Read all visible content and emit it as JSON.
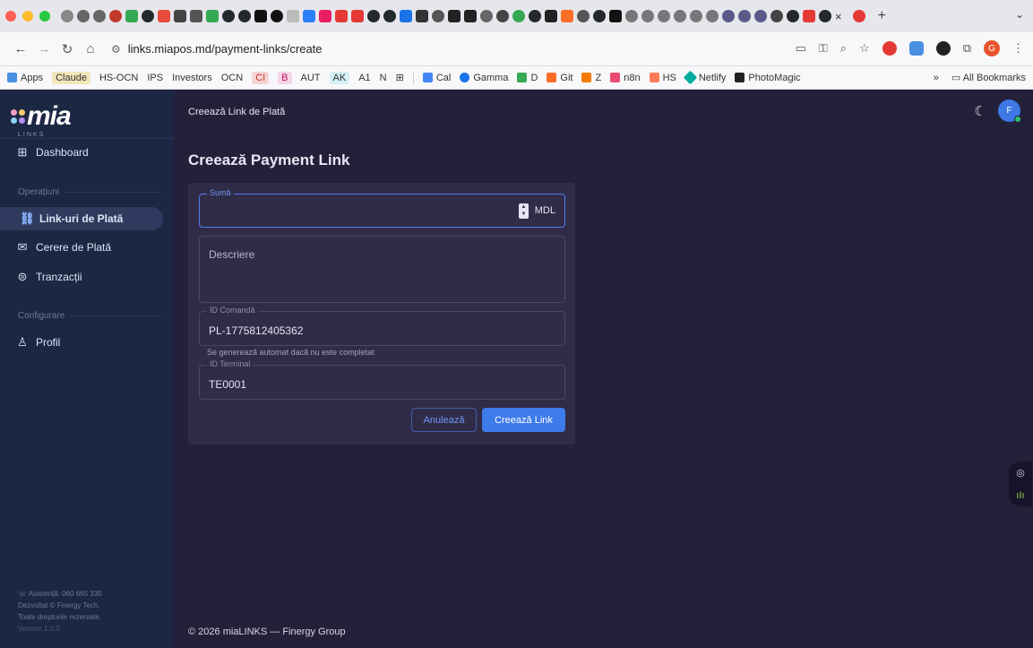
{
  "browser": {
    "url": "links.miapos.md/payment-links/create",
    "bookmarks": [
      "Apps",
      "Claude",
      "HS-OCN",
      "IPS",
      "Investors",
      "OCN",
      "CI",
      "B",
      "AUT",
      "AK",
      "A1",
      "N",
      "Cal",
      "Gamma",
      "D",
      "Git",
      "Z",
      "n8n",
      "HS",
      "Netlify",
      "PhotoMagic"
    ],
    "more_bookmarks": "»",
    "all_bookmarks": "All Bookmarks",
    "tab_close": "×",
    "new_tab": "+",
    "profile_initial": "G"
  },
  "sidebar": {
    "logo_word": "mia",
    "logo_sub": "LINKS",
    "dashboard": "Dashboard",
    "section_operations": "Operațiuni",
    "section_config": "Configurare",
    "items": {
      "payment_links": "Link-uri de Plată",
      "payment_request": "Cerere de Plată",
      "transactions": "Tranzacții",
      "profile": "Profil"
    },
    "support": "☏ Asistență: 060 665 335",
    "developed": "Dezvoltat © Finergy Tech.",
    "rights": "Toate drepturile rezervate.",
    "version": "Version 1.0.0"
  },
  "topbar": {
    "title": "Creează Link de Plată",
    "user_initial": "F"
  },
  "page": {
    "title": "Creează Payment Link"
  },
  "form": {
    "amount_label": "Sumă",
    "amount_value": "",
    "currency": "MDL",
    "description_placeholder": "Descriere",
    "order_label": "ID Comandă",
    "order_value": "PL-1775812405362",
    "order_helper": "Se generează automat dacă nu este completat",
    "terminal_label": "ID Terminal",
    "terminal_value": "TE0001",
    "cancel": "Anulează",
    "create": "Creează Link"
  },
  "footer": {
    "text": "© 2026 miaLINKS — Finergy Group"
  },
  "colors": {
    "sidebar_bg": "#1c2744",
    "page_bg": "#23213a",
    "card_bg": "#302c48",
    "accent": "#3d7bea"
  }
}
